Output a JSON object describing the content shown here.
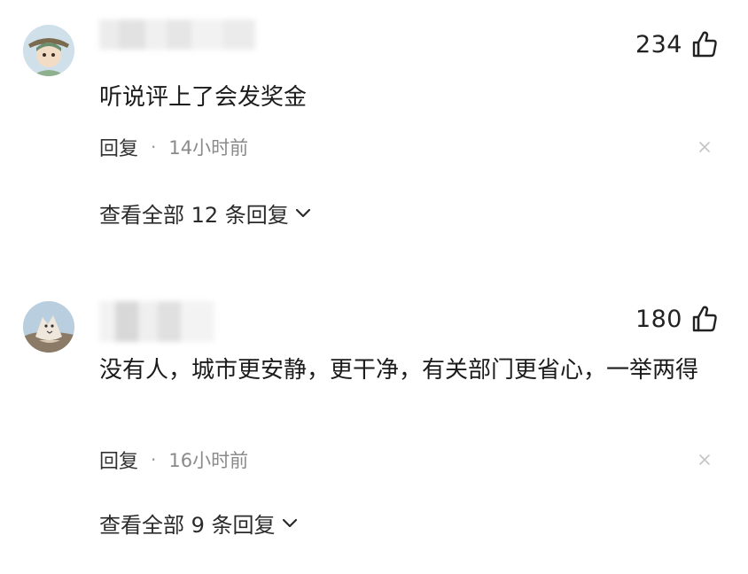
{
  "comments": [
    {
      "likes": "234",
      "text": "听说评上了会发奖金",
      "reply_label": "回复",
      "separator": "·",
      "time": "14小时前",
      "view_replies": "查看全部 12 条回复"
    },
    {
      "likes": "180",
      "text": "没有人，城市更安静，更干净，有关部门更省心，一举两得",
      "reply_label": "回复",
      "separator": "·",
      "time": "16小时前",
      "view_replies": "查看全部 9 条回复"
    }
  ],
  "icons": {
    "like": "thumbs-up-icon",
    "close": "close-icon",
    "expand": "chevron-down-icon"
  },
  "colors": {
    "text": "#1b1b1b",
    "meta": "#8a8a8a",
    "background": "#ffffff"
  }
}
